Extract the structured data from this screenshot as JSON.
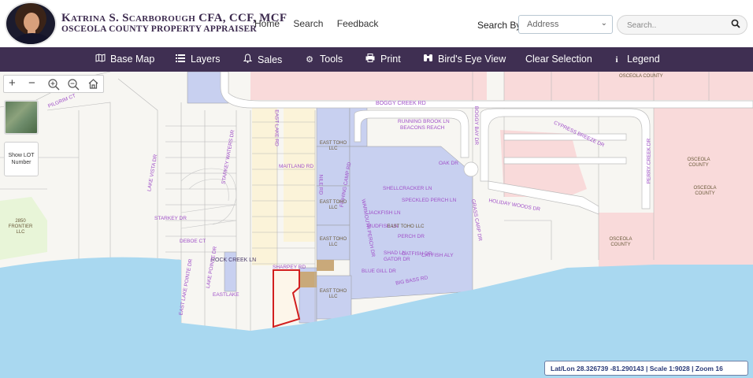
{
  "header": {
    "name": "Katrina S. Scarborough CFA, CCF, MCF",
    "office": "OSCEOLA COUNTY PROPERTY APPRAISER",
    "nav": [
      "Home",
      "Search",
      "Feedback"
    ],
    "search_by_label": "Search By",
    "search_by_value": "Address",
    "search_placeholder": "Search.."
  },
  "toolbar": {
    "items": [
      {
        "label": "Base Map",
        "icon": "map-icon"
      },
      {
        "label": "Layers",
        "icon": "layers-icon"
      },
      {
        "label": "Sales",
        "icon": "bell-icon"
      },
      {
        "label": "Tools",
        "icon": "gear-icon"
      },
      {
        "label": "Print",
        "icon": "print-icon"
      },
      {
        "label": "Bird's Eye View",
        "icon": "binoculars-icon"
      },
      {
        "label": "Clear Selection",
        "icon": ""
      },
      {
        "label": "Legend",
        "icon": "info-icon"
      }
    ]
  },
  "map_controls": {
    "zoom_in": "+",
    "zoom_out": "−",
    "show_lot_number": "Show LOT Number"
  },
  "map": {
    "streets": [
      "BOGGY CREEK RD",
      "PILGRIM CT",
      "LAKE VISTA DR",
      "EAST LAKE RD",
      "MAITLAND RD",
      "NILE RD",
      "RUNNING BROOK LN",
      "BEACONS REACH",
      "BOGGY BAY DR",
      "CYPRESS BREEZE DR",
      "OAK DR",
      "SHELLCRACKER LN",
      "SPECKLED PERCH LN",
      "JACKFISH LN",
      "MUDFISH LN",
      "PERCH DR",
      "SHAD LN",
      "GATOR DR",
      "CATFISH DR",
      "CATFISH ALY",
      "BLUE GILL DR",
      "BIG BASS RD",
      "SHARPEY RD",
      "STARKEY DR",
      "DEBOE CT",
      "EAST LAKE POINTE DR",
      "ROCK CREEK LN",
      "HOLIDAY WOODS DR",
      "WARMOUTH PERCH DR",
      "FISHING CAMP RD",
      "GRASS CARP DR",
      "PERRY CREEK DR",
      "STARKEY WATERS DR",
      "LAKE POINTE DR",
      "EASTLAKE"
    ],
    "owners": [
      "OSCEOLA COUNTY",
      "EAST TOHO LLC",
      "EAST TOHO LLC",
      "EAST TOHO LLC",
      "EAST TOHO LLC",
      "EAST TOHO LLC",
      "2850 FRONTIER LLC",
      "OSCEOLA COUNTY",
      "OSCEOLA COUNTY",
      "OSCEOLA COUNTY"
    ],
    "status": "Lat/Lon 28.326739 -81.290143 | Scale 1:9028 | Zoom 16"
  }
}
